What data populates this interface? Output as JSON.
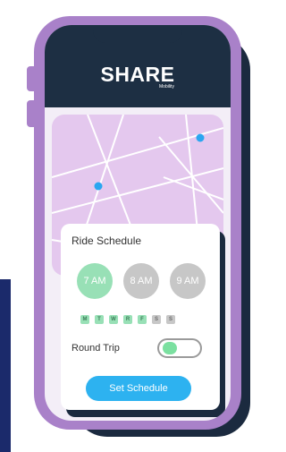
{
  "app": {
    "brand": "SHARE",
    "brand_sub": "Mobility"
  },
  "card": {
    "title": "Ride Schedule",
    "times": [
      {
        "label": "7 AM",
        "selected": true
      },
      {
        "label": "8 AM",
        "selected": false
      },
      {
        "label": "9 AM",
        "selected": false
      }
    ],
    "days": [
      {
        "label": "M",
        "active": true
      },
      {
        "label": "T",
        "active": true
      },
      {
        "label": "W",
        "active": true
      },
      {
        "label": "R",
        "active": true
      },
      {
        "label": "F",
        "active": true
      },
      {
        "label": "S",
        "active": false
      },
      {
        "label": "S",
        "active": false
      }
    ],
    "round_trip_label": "Round Trip",
    "round_trip_on": true,
    "cta_label": "Set Schedule"
  },
  "colors": {
    "header": "#1d2f43",
    "frame": "#a981c9",
    "map": "#e4c8ee",
    "accent_green": "#98e0b6",
    "accent_blue": "#2db2f0",
    "pin": "#2aa6f0"
  },
  "icons": {
    "map_pins": [
      "location-pin-icon",
      "location-pin-icon"
    ]
  }
}
